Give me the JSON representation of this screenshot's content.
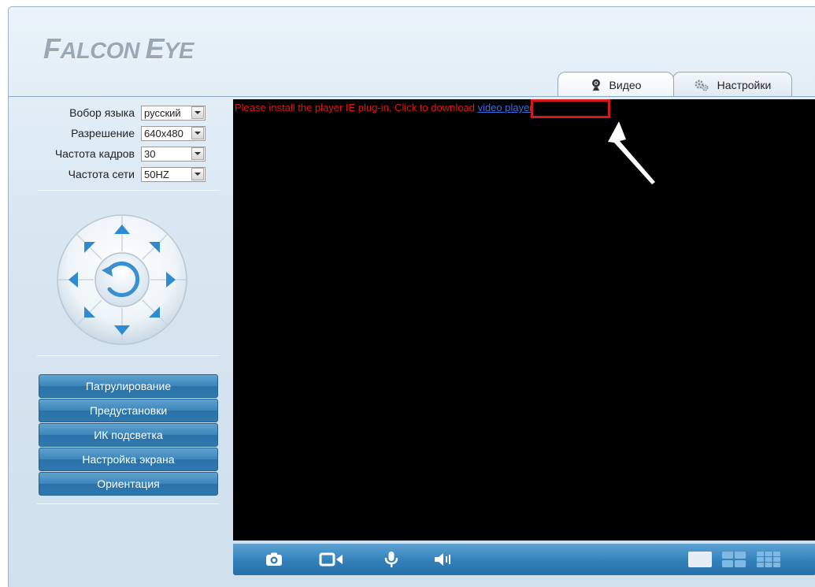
{
  "app": {
    "logo": "Falcon Eye",
    "logo_first": "F",
    "logo_first_rest": "ALCON",
    "logo_second": "E",
    "logo_second_rest": "YE"
  },
  "tabs": [
    {
      "label": "Видео",
      "icon": "webcam-icon",
      "active": true
    },
    {
      "label": "Настройки",
      "icon": "gears-icon",
      "active": false
    }
  ],
  "settings": {
    "language": {
      "label": "Вобор языка",
      "value": "русский"
    },
    "resolution": {
      "label": "Разрешение",
      "value": "640x480"
    },
    "framerate": {
      "label": "Частота кадров",
      "value": "30"
    },
    "netfreq": {
      "label": "Частота сети",
      "value": "50HZ"
    }
  },
  "ptz": {
    "buttons": [
      "up-arrow-icon",
      "up-right-arrow-icon",
      "right-arrow-icon",
      "down-right-arrow-icon",
      "down-arrow-icon",
      "down-left-arrow-icon",
      "left-arrow-icon",
      "up-left-arrow-icon",
      "reset-rotate-icon"
    ]
  },
  "menu": {
    "patrol": "Патрулирование",
    "presets": "Предустановки",
    "ir": "ИК подсветка",
    "screen": "Настройка экрана",
    "orientation": "Ориентация"
  },
  "video": {
    "message": "Please install the player IE plug-in, Click to download ",
    "link": "video player"
  },
  "toolbar": {
    "left": [
      "camera-snapshot-icon",
      "video-record-icon",
      "microphone-icon",
      "speaker-icon"
    ],
    "right": [
      "single-view-icon",
      "quad-view-icon",
      "nine-view-icon"
    ]
  },
  "colors": {
    "accent": "#3483bd",
    "alert": "#e41414",
    "link": "#3c6ee0",
    "highlight": "#d61a1a"
  }
}
